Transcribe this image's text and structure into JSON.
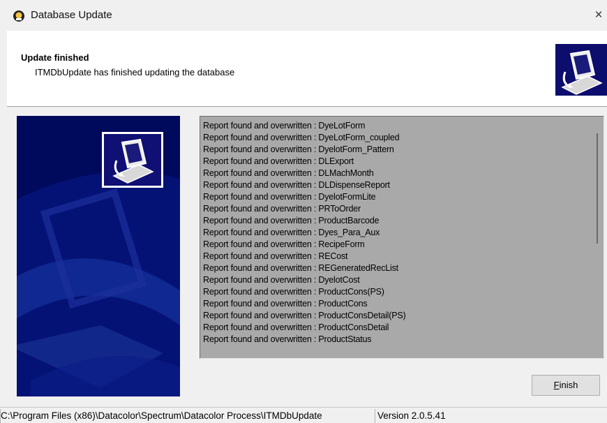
{
  "window": {
    "title": "Database Update",
    "close_label": "×",
    "icon": "database-update-app-icon"
  },
  "header": {
    "title": "Update finished",
    "subtitle": "ITMDbUpdate has finished updating the database",
    "logo_icon": "computer-update-icon"
  },
  "banner": {
    "logo_icon": "computer-update-icon",
    "background_color": "#000a5c"
  },
  "report_list": {
    "items": [
      "Report found and overwritten : DyeLotForm",
      "Report found and overwritten : DyeLotForm_coupled",
      "Report found and overwritten : DyelotForm_Pattern",
      "Report found and overwritten : DLExport",
      "Report found and overwritten : DLMachMonth",
      "Report found and overwritten : DLDispenseReport",
      "Report found and overwritten : DyelotFormLite",
      "Report found and overwritten : PRToOrder",
      "Report found and overwritten : ProductBarcode",
      "Report found and overwritten : Dyes_Para_Aux",
      "Report found and overwritten : RecipeForm",
      "Report found and overwritten : RECost",
      "Report found and overwritten : REGeneratedRecList",
      "Report found and overwritten : DyelotCost",
      "Report found and overwritten : ProductCons(PS)",
      "Report found and overwritten : ProductCons",
      "Report found and overwritten : ProductConsDetail(PS)",
      "Report found and overwritten : ProductConsDetail",
      "Report found and overwritten : ProductStatus"
    ]
  },
  "buttons": {
    "finish_accel": "F",
    "finish_rest": "inish"
  },
  "status_bar": {
    "path": "C:\\Program Files (x86)\\Datacolor\\Spectrum\\Datacolor Process\\ITMDbUpdate",
    "version": "Version 2.0.5.41"
  },
  "colors": {
    "list_background": "#a9a9a9",
    "banner_navy": "#000a5c",
    "window_background": "#f0f0f0"
  }
}
